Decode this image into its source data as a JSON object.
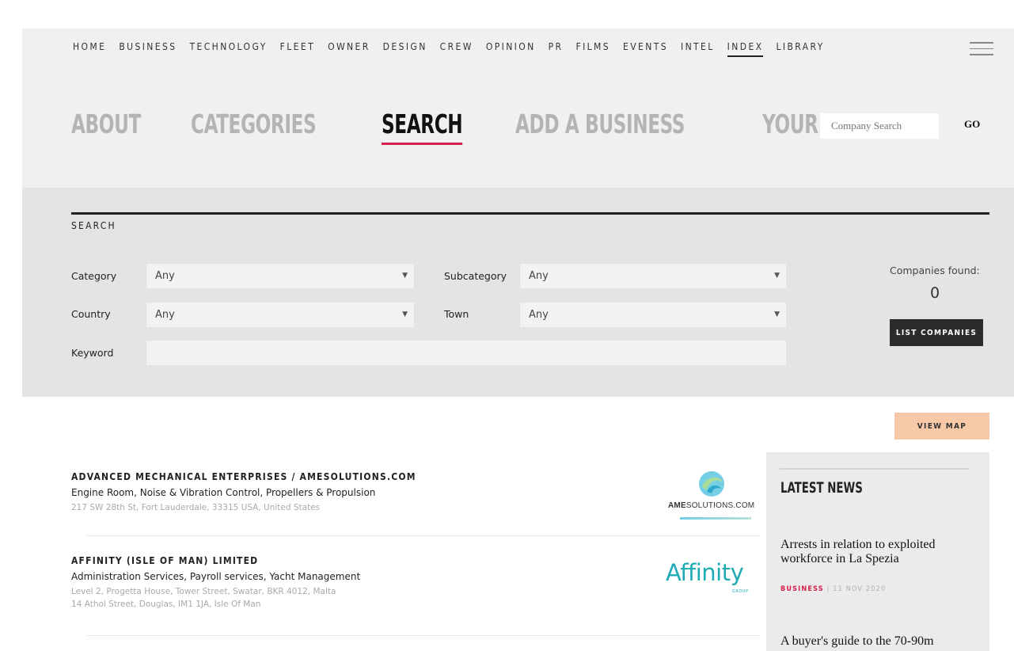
{
  "top_nav": {
    "items": [
      "HOME",
      "BUSINESS",
      "TECHNOLOGY",
      "FLEET",
      "OWNER",
      "DESIGN",
      "CREW",
      "OPINION",
      "PR",
      "FILMS",
      "EVENTS",
      "INTEL",
      "INDEX",
      "LIBRARY"
    ],
    "active": "INDEX"
  },
  "sub_nav": {
    "items": [
      "ABOUT",
      "CATEGORIES",
      "SEARCH",
      "ADD A BUSINESS",
      "YOUR ACCOUNT"
    ],
    "active": "SEARCH"
  },
  "company_search": {
    "placeholder": "Company Search",
    "go_label": "GO"
  },
  "search_panel": {
    "title": "SEARCH",
    "category_label": "Category",
    "category_value": "Any",
    "subcategory_label": "Subcategory",
    "subcategory_value": "Any",
    "country_label": "Country",
    "country_value": "Any",
    "town_label": "Town",
    "town_value": "Any",
    "keyword_label": "Keyword",
    "keyword_value": "",
    "found_label": "Companies found:",
    "found_count": "0",
    "list_button": "LIST COMPANIES"
  },
  "view_map_label": "VIEW MAP",
  "results": [
    {
      "name": "ADVANCED MECHANICAL ENTERPRISES / AMESOLUTIONS.COM",
      "categories": "Engine Room, Noise & Vibration Control, Propellers & Propulsion",
      "address_lines": [
        "217 SW 28th St, Fort Lauderdale, 33315 USA, United States"
      ],
      "logo_text_bold": "AME",
      "logo_text": "SOLUTIONS.COM"
    },
    {
      "name": "AFFINITY (ISLE OF MAN) LIMITED",
      "categories": "Administration Services, Payroll services, Yacht Management",
      "address_lines": [
        "Level 2, Progetta House, Tower Street, Swatar, BKR 4012, Malta",
        "14 Athol Street, Douglas, IM1 1JA, Isle Of Man"
      ],
      "logo_text": "Affinity",
      "logo_subtext": "GROUP"
    }
  ],
  "latest_news": {
    "title": "LATEST NEWS",
    "items": [
      {
        "headline": "Arrests in relation to exploited workforce in La Spezia",
        "category": "BUSINESS",
        "date": "11 NOV 2020"
      },
      {
        "headline": "A buyer's guide to the 70-90m"
      }
    ]
  },
  "colors": {
    "accent_red": "#d81e4b",
    "affinity_teal": "#1eaab5",
    "view_map_peach": "#f8c9a8"
  }
}
